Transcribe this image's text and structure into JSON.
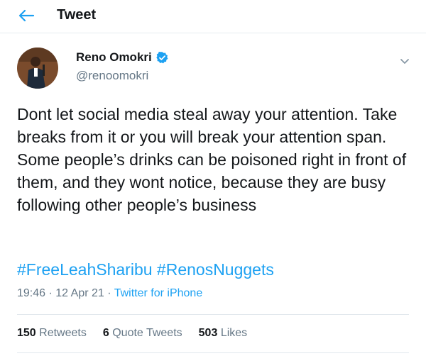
{
  "header": {
    "title": "Tweet",
    "back_icon": "arrow-left-icon"
  },
  "author": {
    "display_name": "Reno Omokri",
    "handle": "@renoomokri",
    "verified": true
  },
  "tweet": {
    "text": "Dont let social media steal away your attention. Take breaks from it or you will break your attention span. Some people’s drinks can be poisoned right in front of them, and they wont notice, because they are busy following other people’s business",
    "hashtags": [
      "#FreeLeahSharibu",
      "#RenosNuggets"
    ],
    "time": "19:46",
    "separator": "·",
    "date": "12 Apr 21",
    "source": "Twitter for iPhone"
  },
  "stats": [
    {
      "count": "150",
      "label": "Retweets"
    },
    {
      "count": "6",
      "label": "Quote Tweets"
    },
    {
      "count": "503",
      "label": "Likes"
    }
  ],
  "colors": {
    "accent": "#1da1f2",
    "text": "#14171a",
    "secondary": "#657786"
  }
}
